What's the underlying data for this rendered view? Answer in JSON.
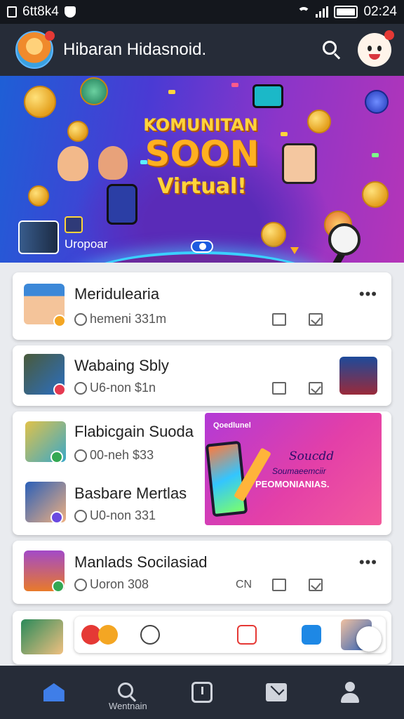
{
  "status_bar": {
    "left_text": "6tt8k4",
    "time": "02:24"
  },
  "header": {
    "title": "Hibaran Hidasnoid."
  },
  "banner": {
    "line1": "KOMUNITAN",
    "line2": "SOON",
    "line3": "Virtual!",
    "caption": "Uropoar"
  },
  "feed": {
    "items": [
      {
        "title": "Meridulearia",
        "meta": "hemeni 331m"
      },
      {
        "title": "Wabaing Sbly",
        "meta": "U6-non $1n"
      },
      {
        "title": "Flabicgain Suoda",
        "meta": "00-neh $33"
      },
      {
        "title": "Basbare Mertlas",
        "meta": "U0-non 331"
      },
      {
        "title": "Manlads Socilasiad",
        "meta": "Uoron 308",
        "extra": "CN"
      }
    ],
    "more_label": "•••",
    "promo": {
      "tag": "Qoedlunel",
      "line1": "Soucdd",
      "line2": "Soumaeemciir",
      "line3": "PEOMONIANIAS."
    }
  },
  "bottom_nav": {
    "items": [
      {
        "label": "",
        "icon": "home-icon"
      },
      {
        "label": "Wentnain",
        "icon": "search-icon"
      },
      {
        "label": "",
        "icon": "clock-icon"
      },
      {
        "label": "",
        "icon": "mail-icon"
      },
      {
        "label": "",
        "icon": "profile-icon"
      }
    ]
  },
  "colors": {
    "header_bg": "#262c38",
    "accent": "#3f7ee8",
    "badge_red": "#e53935"
  }
}
